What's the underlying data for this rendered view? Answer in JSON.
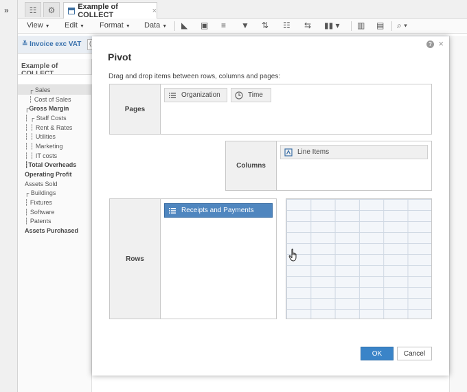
{
  "toolbar": {
    "doc_tab_label": "Example of COLLECT",
    "tab_close": "×",
    "expand_glyph": "»"
  },
  "menu": {
    "view": "View",
    "edit": "Edit",
    "format": "Format",
    "data": "Data"
  },
  "filter": {
    "invoice_label": "Invoice exc VAT",
    "second_filter": "("
  },
  "tree": {
    "title": "Example of COLLECT",
    "items": [
      {
        "label": "Sales",
        "bold": false
      },
      {
        "label": "Cost of Sales",
        "bold": false
      },
      {
        "label": "Gross Margin",
        "bold": true
      },
      {
        "label": "Staff Costs",
        "bold": false
      },
      {
        "label": "Rent & Rates",
        "bold": false
      },
      {
        "label": "Utilities",
        "bold": false
      },
      {
        "label": "Marketing",
        "bold": false
      },
      {
        "label": "IT costs",
        "bold": false
      },
      {
        "label": "Total Overheads",
        "bold": true
      },
      {
        "label": "Operating Profit",
        "bold": true
      },
      {
        "label": "Assets Sold",
        "bold": false
      },
      {
        "label": "Buildings",
        "bold": false
      },
      {
        "label": "Fixtures",
        "bold": false
      },
      {
        "label": "Software",
        "bold": false
      },
      {
        "label": "Patents",
        "bold": false
      },
      {
        "label": "Assets Purchased",
        "bold": true
      }
    ]
  },
  "dialog": {
    "title": "Pivot",
    "help": "?",
    "close": "×",
    "instructions": "Drag and drop items between rows, columns and pages:",
    "pages": {
      "label": "Pages",
      "items": [
        "Organization",
        "Time"
      ]
    },
    "columns": {
      "label": "Columns",
      "items": [
        "Line Items"
      ]
    },
    "rows": {
      "label": "Rows",
      "items": [
        "Receipts and Payments"
      ]
    },
    "ok_label": "OK",
    "cancel_label": "Cancel"
  },
  "colors": {
    "accent": "#3a84c8",
    "chip_active": "#4f86bf",
    "zone_label_bg": "#f0f0f0"
  }
}
